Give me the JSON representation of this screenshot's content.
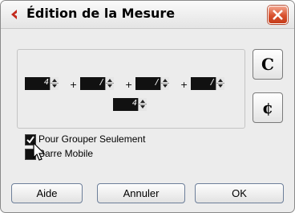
{
  "window": {
    "title": "Édition de la Mesure",
    "accent_color": "#c3281b"
  },
  "signature": {
    "numerators": [
      {
        "value": "4"
      },
      {
        "value": "/"
      },
      {
        "value": "/"
      },
      {
        "value": "/"
      }
    ],
    "plus_sign": "+",
    "denominator": "4"
  },
  "time_buttons": {
    "common_time": "C",
    "cut_time": "¢"
  },
  "options": {
    "group_only": {
      "label": "Pour Grouper Seulement",
      "checked": true
    },
    "movable_bar": {
      "label": "Barre Mobile",
      "checked": false
    }
  },
  "buttons": {
    "help": "Aide",
    "cancel": "Annuler",
    "ok": "OK"
  }
}
